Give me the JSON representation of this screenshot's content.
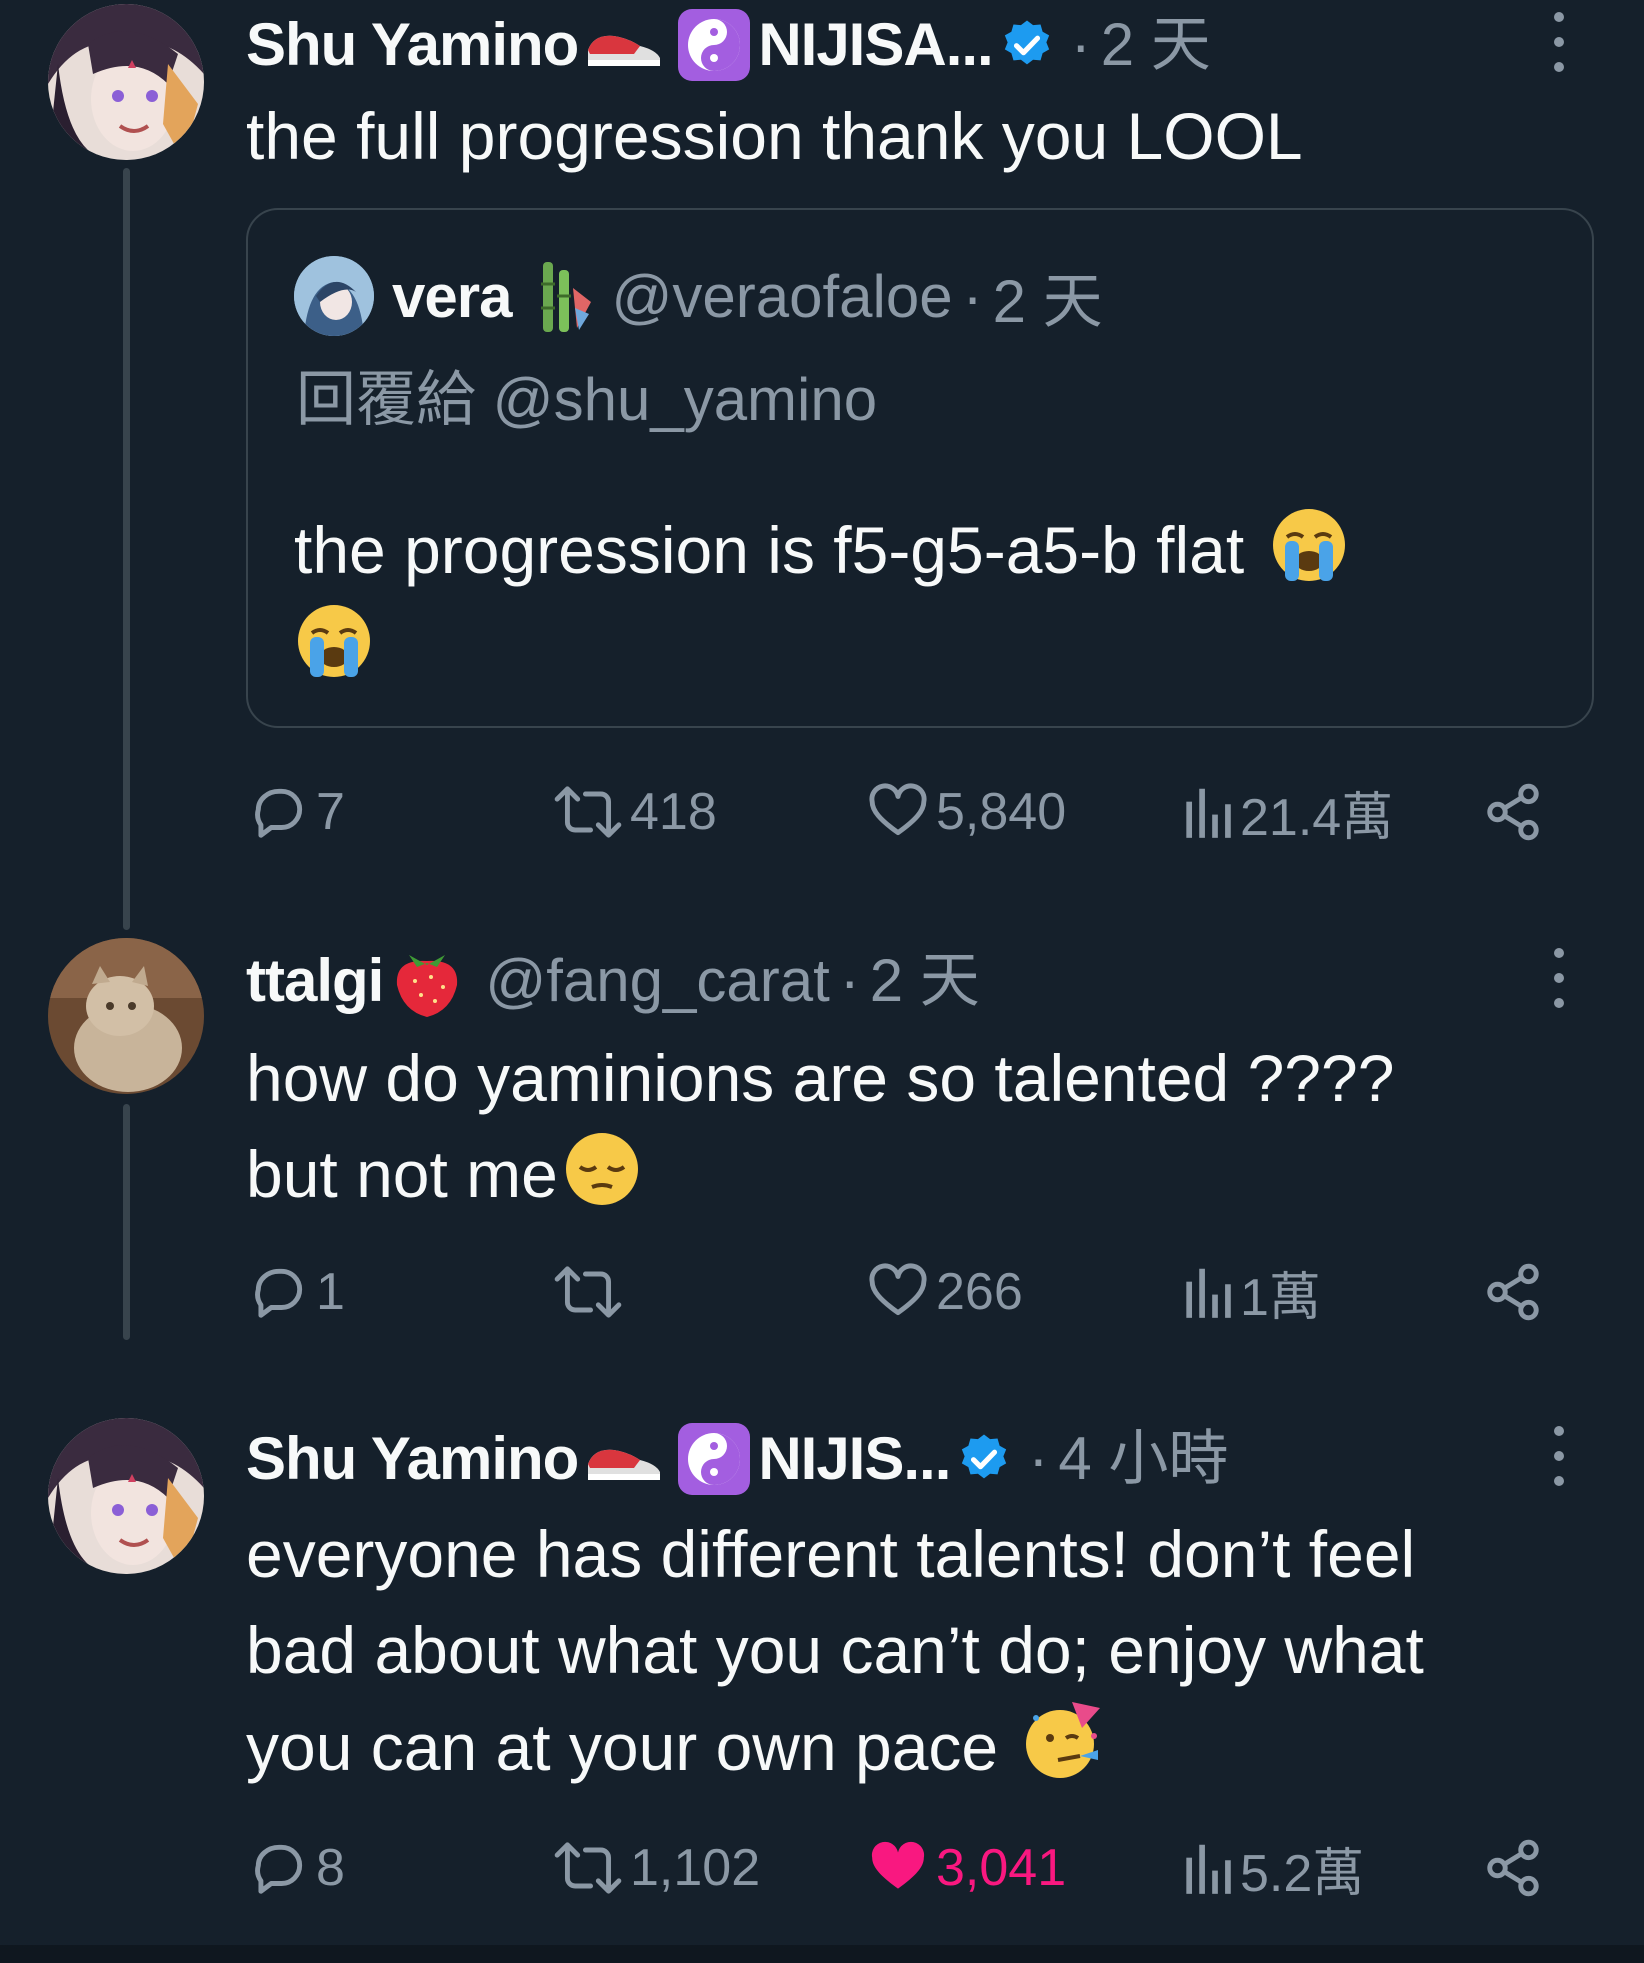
{
  "tweets": [
    {
      "display_name": "Shu Yamino",
      "org_label": "NIJISA...",
      "time": "2 天",
      "text": "the full progression thank you LOOL",
      "quote": {
        "display_name": "vera",
        "handle": "@veraofaloe",
        "time": "2 天",
        "reply_prefix": "回覆給",
        "reply_handle": "@shu_yamino",
        "text": "the progression is f5-g5-a5-b flat"
      },
      "stats": {
        "replies": "7",
        "retweets": "418",
        "likes": "5,840",
        "views": "21.4萬"
      }
    },
    {
      "display_name": "ttalgi",
      "handle": "@fang_carat",
      "time": "2 天",
      "text_line1": "how do yaminions are so talented ????",
      "text_line2": "but not me",
      "stats": {
        "replies": "1",
        "retweets": "",
        "likes": "266",
        "views": "1萬"
      }
    },
    {
      "display_name": "Shu Yamino",
      "org_label": "NIJIS...",
      "time": "4 小時",
      "text_line1": "everyone has different talents! don’t feel",
      "text_line2": "bad about what you can’t do; enjoy what",
      "text_line3": "you can at your own pace",
      "stats": {
        "replies": "8",
        "retweets": "1,102",
        "likes": "3,041",
        "views": "5.2萬",
        "liked": true
      }
    }
  ],
  "colors": {
    "background": "#15202b",
    "muted": "#8b98a5",
    "border": "#38444d",
    "verified": "#1d9bf0",
    "like_active": "#f91880"
  }
}
